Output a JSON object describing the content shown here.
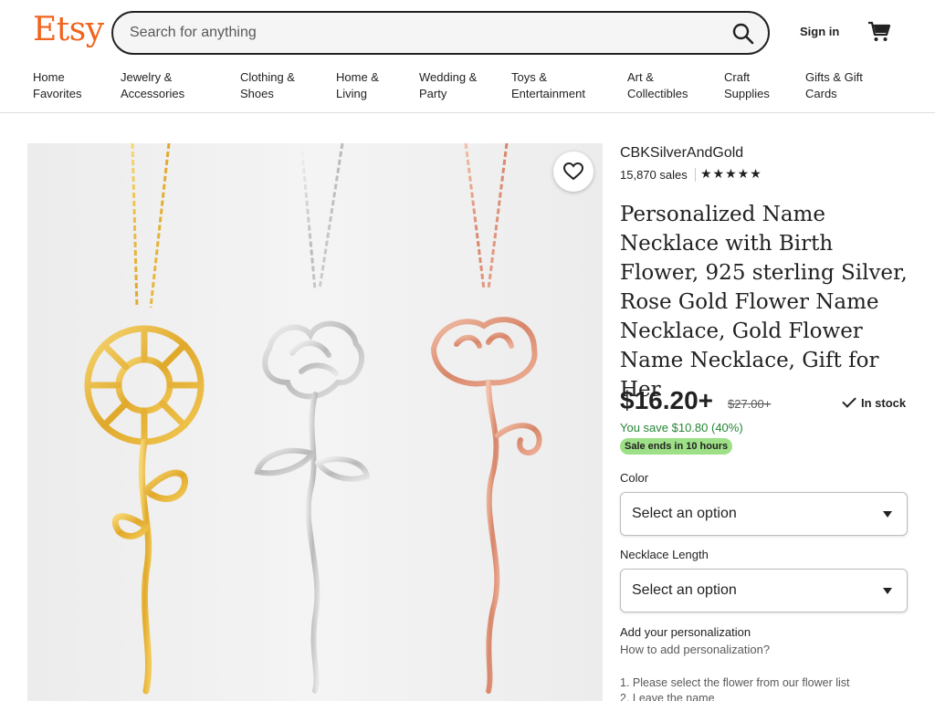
{
  "header": {
    "logo": "Etsy",
    "search_placeholder": "Search for anything",
    "sign_in": "Sign in"
  },
  "categories": [
    {
      "line1": "Home",
      "line2": "Favorites"
    },
    {
      "line1": "Jewelry &",
      "line2": "Accessories"
    },
    {
      "line1": "Clothing &",
      "line2": "Shoes"
    },
    {
      "line1": "Home &",
      "line2": "Living"
    },
    {
      "line1": "Wedding &",
      "line2": "Party"
    },
    {
      "line1": "Toys &",
      "line2": "Entertainment"
    },
    {
      "line1": "Art &",
      "line2": "Collectibles"
    },
    {
      "line1": "Craft",
      "line2": "Supplies"
    },
    {
      "line1": "Gifts & Gift",
      "line2": "Cards"
    }
  ],
  "listing": {
    "shop_name": "CBKSilverAndGold",
    "sales": "15,870 sales",
    "rating_stars": "★★★★★",
    "title": "Personalized Name Necklace with Birth Flower, 925 sterling Silver, Rose Gold Flower Name Necklace, Gold Flower Name Necklace, Gift for Her",
    "price": "$16.20+",
    "original_price": "$27.00+",
    "stock": "In stock",
    "savings": "You save $10.80 (40%)",
    "sale_badge": "Sale ends in 10 hours",
    "color_label": "Color",
    "color_value": "Select an option",
    "length_label": "Necklace Length",
    "length_value": "Select an option",
    "personalization_label": "Add your personalization",
    "personalization_link": "How to add personalization?",
    "instructions": [
      "1. Please select the flower from our flower list",
      "2. Leave the name"
    ]
  },
  "colors": {
    "brand": "#f1641e",
    "sale_green": "#258635",
    "badge_green": "#9ee087"
  },
  "icons": {
    "search": "search-icon",
    "cart": "cart-icon",
    "favorite": "heart-icon"
  }
}
